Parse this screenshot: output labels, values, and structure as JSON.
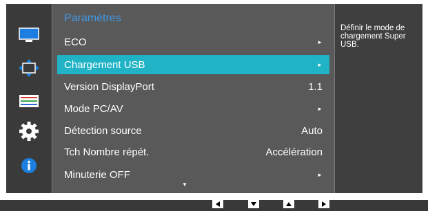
{
  "menu": {
    "title": "Paramètres",
    "items": [
      {
        "label": "ECO",
        "value": "",
        "arrow": "►"
      },
      {
        "label": "Chargement USB",
        "value": "",
        "arrow": "►"
      },
      {
        "label": "Version DisplayPort",
        "value": "1.1",
        "arrow": ""
      },
      {
        "label": "Mode PC/AV",
        "value": "",
        "arrow": "►"
      },
      {
        "label": "Détection source",
        "value": "Auto",
        "arrow": ""
      },
      {
        "label": "Tch Nombre répét.",
        "value": "Accélération",
        "arrow": ""
      },
      {
        "label": "Minuterie OFF",
        "value": "",
        "arrow": "►"
      }
    ],
    "selected_index": 1,
    "scroll_indicator": "▼"
  },
  "help": {
    "text": "Définir le mode de chargement Super USB."
  },
  "sidebar": {
    "icons": [
      "monitor-icon",
      "position-arrows-icon",
      "color-adjust-icon",
      "gear-icon",
      "info-icon"
    ]
  },
  "colors": {
    "accent": "#1fb3c5",
    "title": "#3f9ae8"
  }
}
